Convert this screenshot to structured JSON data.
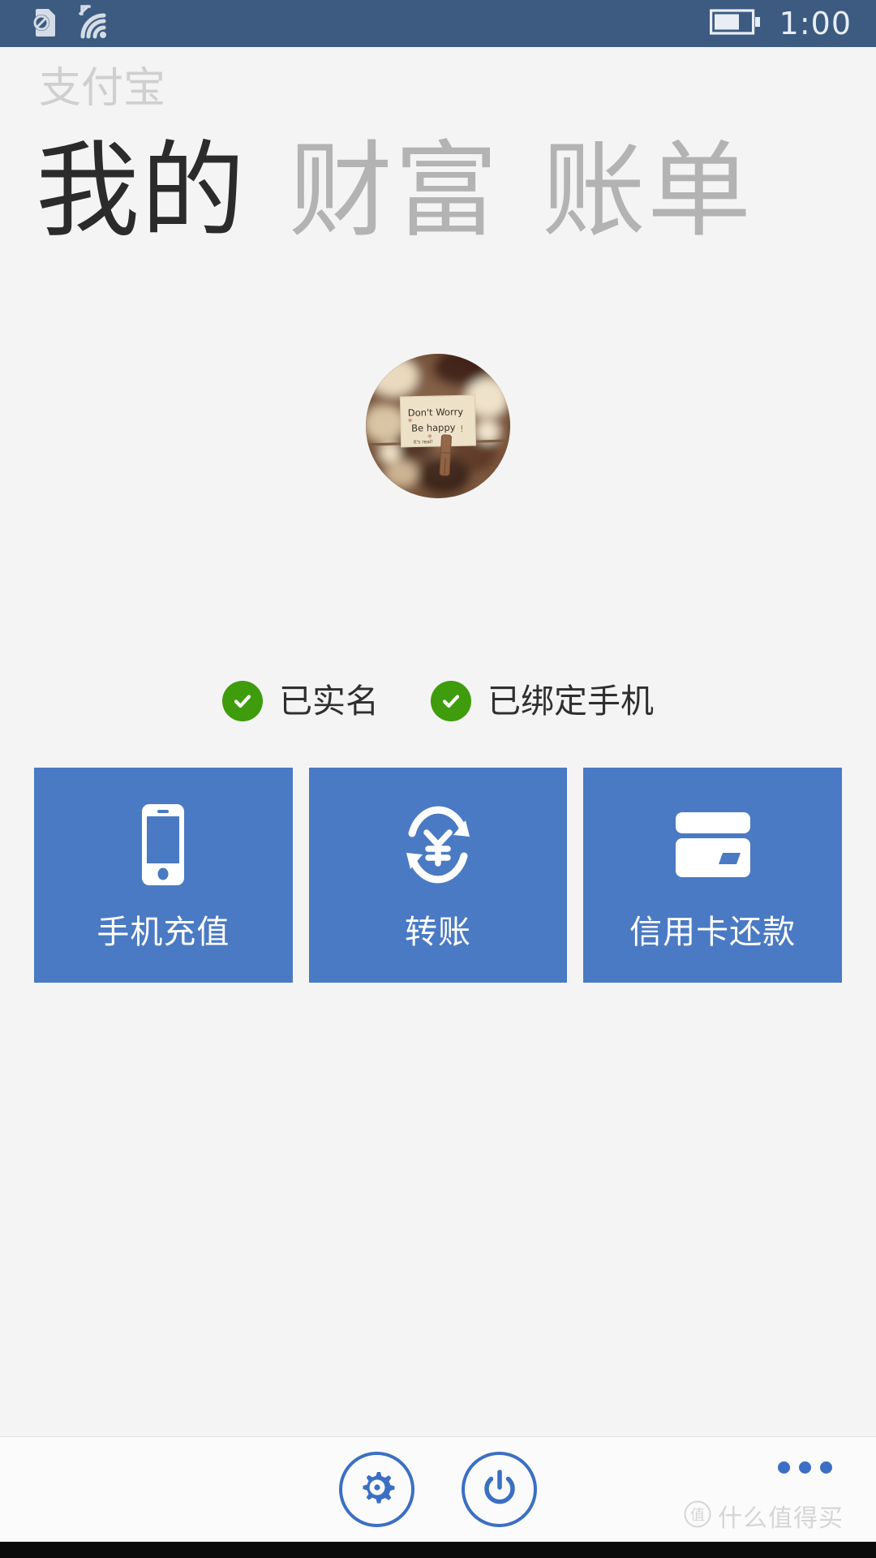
{
  "statusbar": {
    "clock": "1:00",
    "icons": {
      "sim": "sim-card-disabled-icon",
      "wifi": "wifi-signal-icon",
      "battery": "battery-icon"
    }
  },
  "brand": {
    "name": "支付宝",
    "alt": "alipay-logo"
  },
  "pivot": {
    "items": [
      {
        "label": "我的",
        "state": "active"
      },
      {
        "label": "财富",
        "state": "inactive"
      },
      {
        "label": "账单",
        "state": "inactive"
      }
    ]
  },
  "profile": {
    "avatar_name": "user-avatar",
    "avatar_caption_line1": "Don't Worry",
    "avatar_caption_line2": "Be happy !",
    "avatar_caption_line3": "it's real!"
  },
  "badges": [
    {
      "label": "已实名",
      "icon": "check-circle-icon",
      "color": "#3f9c0c"
    },
    {
      "label": "已绑定手机",
      "icon": "check-circle-icon",
      "color": "#3f9c0c"
    }
  ],
  "tiles": [
    {
      "label": "手机充值",
      "icon": "mobile-phone-icon"
    },
    {
      "label": "转账",
      "icon": "yuan-transfer-icon"
    },
    {
      "label": "信用卡还款",
      "icon": "credit-card-icon"
    }
  ],
  "appbar": {
    "buttons": [
      {
        "label": "设置",
        "icon": "gear-icon"
      },
      {
        "label": "退出",
        "icon": "power-icon"
      }
    ],
    "more": "more-ellipsis-icon"
  },
  "watermark": {
    "text": "什么值得买",
    "mark": "值"
  },
  "colors": {
    "statusbar": "#3d5a80",
    "tile": "#4a7ac4",
    "accent": "#3b6fc4",
    "badge_green": "#3f9c0c",
    "page_bg": "#f4f4f4",
    "pivot_active": "#2b2b2b",
    "pivot_inactive": "#b3b3b3"
  }
}
